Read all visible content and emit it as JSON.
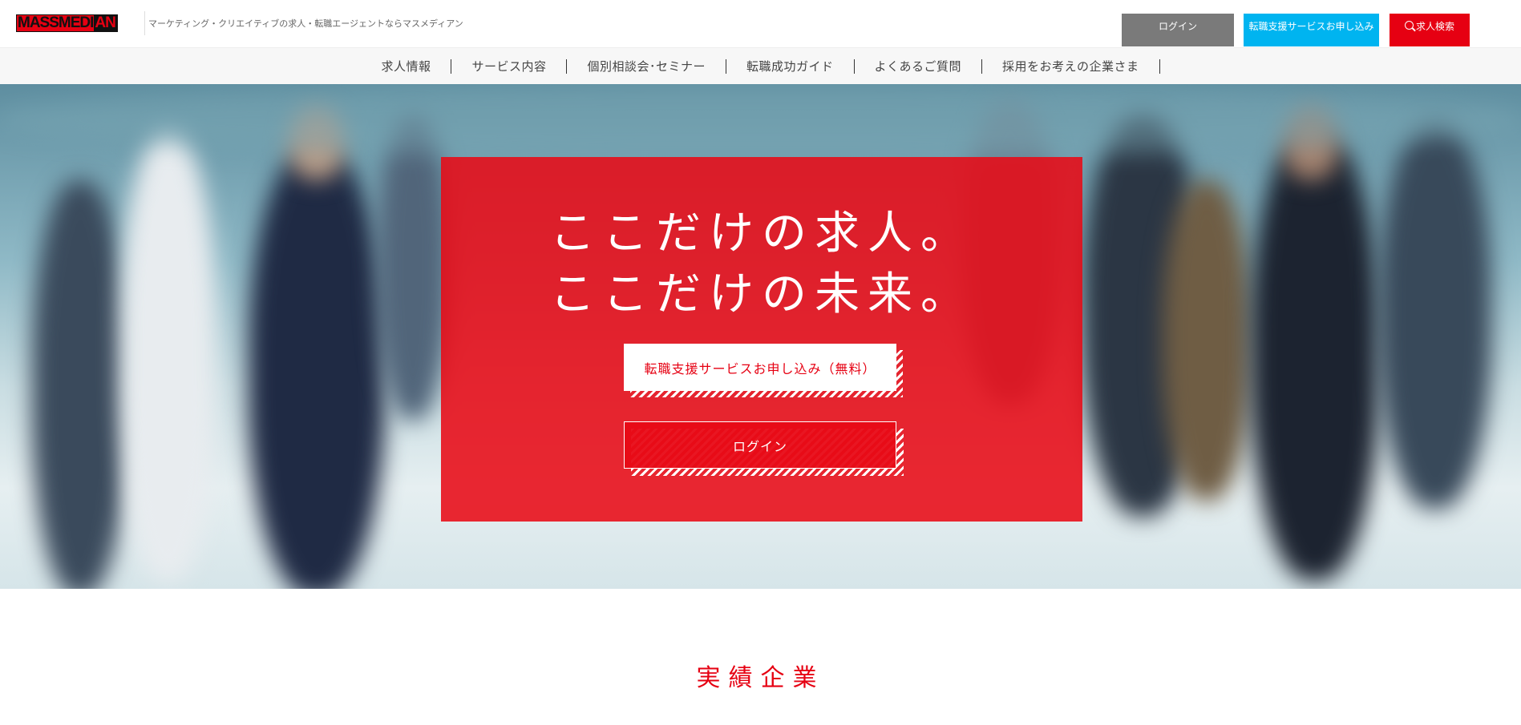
{
  "header": {
    "logo_primary": "MASSMEDI",
    "logo_secondary": "AN",
    "tagline": "マーケティング・クリエイティブの求人・転職エージェントならマスメディアン",
    "buttons": {
      "login": "ログイン",
      "apply": "転職支援サービスお申し込み",
      "search": "求人検索"
    }
  },
  "nav": {
    "items": [
      {
        "label": "求人情報"
      },
      {
        "label": "サービス内容"
      },
      {
        "label": "個別相談会･セミナー"
      },
      {
        "label": "転職成功ガイド"
      },
      {
        "label": "よくあるご質問"
      },
      {
        "label": "採用をお考えの企業さま"
      }
    ]
  },
  "hero": {
    "headline_line1": "ここだけの求人。",
    "headline_line2": "ここだけの未来。",
    "cta_primary": "転職支援サービスお申し込み（無料）",
    "cta_secondary": "ログイン"
  },
  "section": {
    "title": "実績企業"
  },
  "colors": {
    "brand_red": "#e60012",
    "apply_blue": "#00b4f0",
    "login_gray": "#7a7a7a"
  }
}
